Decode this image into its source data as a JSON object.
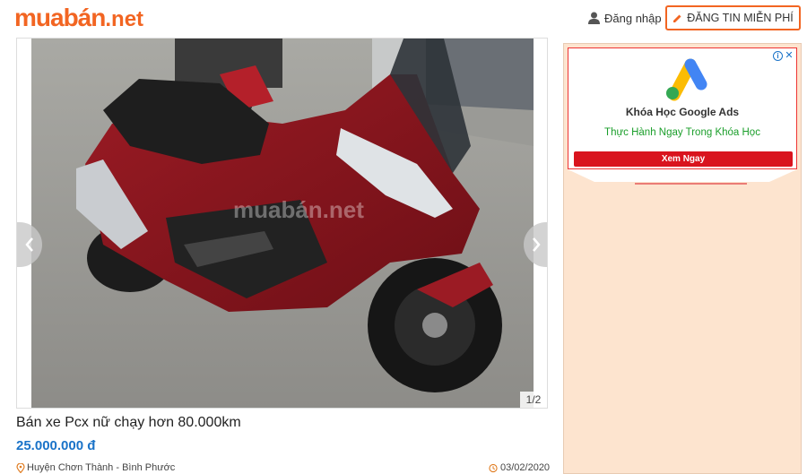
{
  "header": {
    "logo_brand": "muabán",
    "logo_tld": ".net",
    "login_label": "Đăng nhập",
    "post_button_label": "ĐĂNG TIN MIỄN PHÍ"
  },
  "gallery": {
    "watermark": "muabán.net",
    "counter": "1/2"
  },
  "listing": {
    "title": "Bán xe Pcx nữ chạy hơn 80.000km",
    "price": "25.000.000 đ",
    "location": "Huyện Chơn Thành - Bình Phước",
    "date": "03/02/2020"
  },
  "ad": {
    "title": "Khóa Học Google Ads",
    "subtitle": "Thực Hành Ngay Trong Khóa Học",
    "cta": "Xem Ngay",
    "info_glyph": "i",
    "close_glyph": "✕"
  },
  "icons": {
    "user": "user-icon",
    "pencil": "pencil-icon",
    "location": "location-pin-icon",
    "clock": "clock-icon"
  },
  "colors": {
    "brand": "#f26522",
    "price": "#1a73c8",
    "ad_background": "#fde4cf",
    "ad_cta": "#d9141e",
    "ad_subtitle": "#1a9e2a"
  }
}
